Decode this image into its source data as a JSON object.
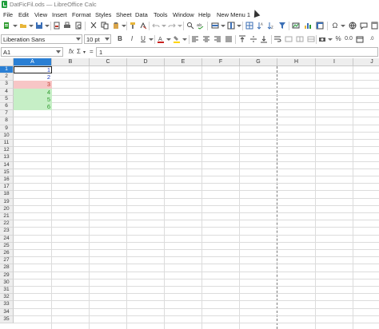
{
  "window": {
    "title": "DatFicFil.ods — LibreOffice Calc"
  },
  "menu": [
    "File",
    "Edit",
    "View",
    "Insert",
    "Format",
    "Styles",
    "Sheet",
    "Data",
    "Tools",
    "Window",
    "Help",
    "New Menu 1"
  ],
  "toolbar2": {
    "font_name": "Liberation Sans",
    "font_size": "10 pt"
  },
  "formula_bar": {
    "cell_ref": "A1",
    "content": "1",
    "fx": "fx",
    "sigma": "Σ",
    "equals": "="
  },
  "columns": [
    "A",
    "B",
    "C",
    "D",
    "E",
    "F",
    "G",
    "H",
    "I",
    "J"
  ],
  "selected_column": "A",
  "rows": [
    "1",
    "2",
    "3",
    "4",
    "5",
    "6",
    "7",
    "8",
    "9",
    "10",
    "11",
    "12",
    "13",
    "14",
    "15",
    "16",
    "17",
    "18",
    "19",
    "20",
    "21",
    "22",
    "23",
    "24",
    "25",
    "26",
    "27",
    "28",
    "29",
    "30",
    "31",
    "32",
    "33",
    "34",
    "35"
  ],
  "selected_row": "1",
  "cells": [
    {
      "ref": "A1",
      "value": "1",
      "bg": "#ffffff",
      "color": "#1f3fbf"
    },
    {
      "ref": "A2",
      "value": "2",
      "bg": "#ffffff",
      "color": "#1f3fbf"
    },
    {
      "ref": "A3",
      "value": "3",
      "bg": "#f7c6c6",
      "color": "#c0392b"
    },
    {
      "ref": "A4",
      "value": "4",
      "bg": "#c6efc6",
      "color": "#2e9b2e"
    },
    {
      "ref": "A5",
      "value": "5",
      "bg": "#c6efc6",
      "color": "#2e9b2e"
    },
    {
      "ref": "A6",
      "value": "6",
      "bg": "#c6efc6",
      "color": "#2e9b2e"
    }
  ]
}
